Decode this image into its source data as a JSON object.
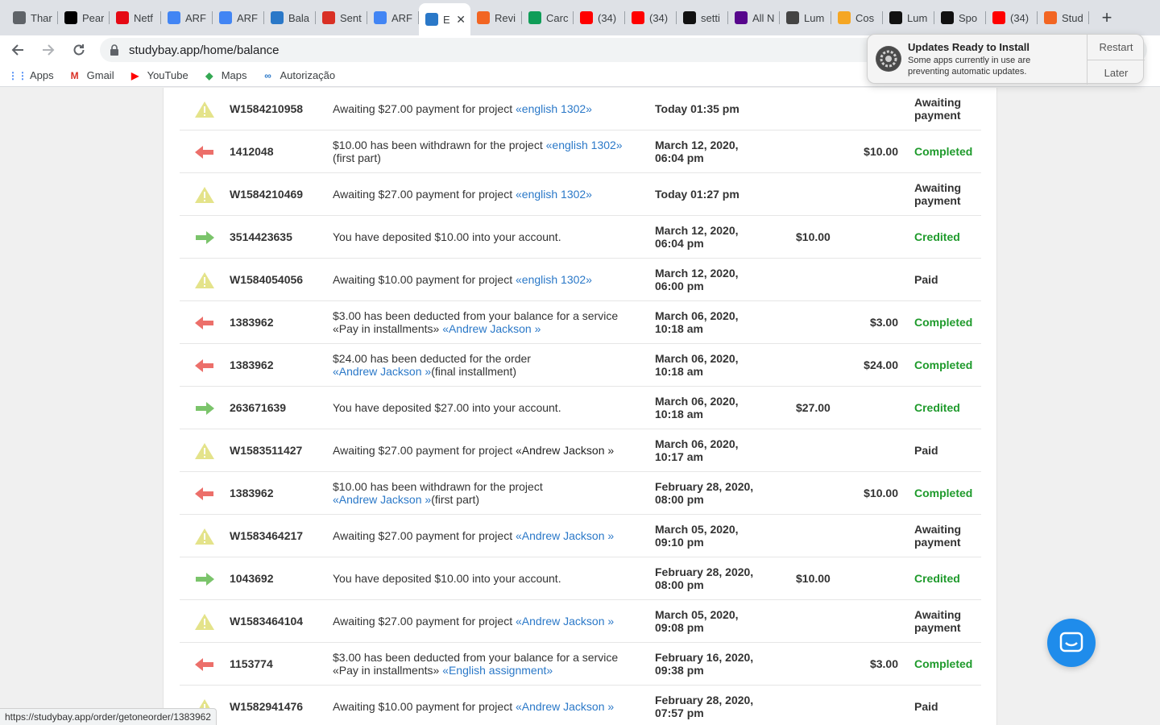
{
  "browser": {
    "tabs": [
      {
        "title": "Thar",
        "icon": "globe-icon",
        "color": "#5f6368"
      },
      {
        "title": "Pear",
        "icon": "pearson-icon",
        "color": "#000000"
      },
      {
        "title": "Netf",
        "icon": "netflix-icon",
        "color": "#e50914"
      },
      {
        "title": "ARF",
        "icon": "docs-icon",
        "color": "#4285f4"
      },
      {
        "title": "ARF",
        "icon": "docs-icon",
        "color": "#4285f4"
      },
      {
        "title": "Bala",
        "icon": "studybay-icon",
        "color": "#2a78c8"
      },
      {
        "title": "Sent",
        "icon": "gmail-icon",
        "color": "#d93025"
      },
      {
        "title": "ARF",
        "icon": "docs-icon",
        "color": "#4285f4"
      },
      {
        "title": "E",
        "icon": "studybay-icon",
        "color": "#2a78c8",
        "active": true
      },
      {
        "title": "Revi",
        "icon": "star-icon",
        "color": "#f26522"
      },
      {
        "title": "Carc",
        "icon": "square-icon",
        "color": "#0f9d58"
      },
      {
        "title": "(34)",
        "icon": "youtube-icon",
        "color": "#ff0000"
      },
      {
        "title": "(34)",
        "icon": "youtube-icon",
        "color": "#ff0000"
      },
      {
        "title": "setti",
        "icon": "k-icon",
        "color": "#111111"
      },
      {
        "title": "All N",
        "icon": "nyu-icon",
        "color": "#57068c"
      },
      {
        "title": "Lum",
        "icon": "lumen-icon",
        "color": "#444444"
      },
      {
        "title": "Cos",
        "icon": "u-icon",
        "color": "#f5a623"
      },
      {
        "title": "Lum",
        "icon": "l-icon",
        "color": "#111111"
      },
      {
        "title": "Spo",
        "icon": "k-icon",
        "color": "#111111"
      },
      {
        "title": "(34)",
        "icon": "youtube-icon",
        "color": "#ff0000"
      },
      {
        "title": "Stud",
        "icon": "star-icon",
        "color": "#f26522"
      }
    ],
    "url": "studybay.app/home/balance",
    "bookmarks": [
      {
        "label": "Apps",
        "icon": "apps-grid-icon"
      },
      {
        "label": "Gmail",
        "icon": "gmail-icon"
      },
      {
        "label": "YouTube",
        "icon": "youtube-icon"
      },
      {
        "label": "Maps",
        "icon": "maps-icon"
      },
      {
        "label": "Autorização",
        "icon": "studybay-icon"
      }
    ],
    "status_url": "https://studybay.app/order/getoneorder/1383962"
  },
  "notification": {
    "title": "Updates Ready to Install",
    "body": "Some apps currently in use are preventing automatic updates.",
    "restart": "Restart",
    "later": "Later"
  },
  "transactions": [
    {
      "type": "warning",
      "id": "W1584210958",
      "text": "Awaiting $27.00 payment for project ",
      "link": "«english 1302»",
      "date1": "Today 01:35 pm",
      "date2": "",
      "credit": "",
      "debit": "",
      "status1": "Awaiting",
      "status2": "payment",
      "green": false
    },
    {
      "type": "out",
      "id": "1412048",
      "text": "$10.00 has been withdrawn for the project ",
      "link": "«english 1302»",
      "suffix": "(first part)",
      "date1": "March 12, 2020,",
      "date2": "06:04 pm",
      "credit": "",
      "debit": "$10.00",
      "status1": "Completed",
      "status2": "",
      "green": true
    },
    {
      "type": "warning",
      "id": "W1584210469",
      "text": "Awaiting $27.00 payment for project ",
      "link": "«english 1302»",
      "date1": "Today 01:27 pm",
      "date2": "",
      "credit": "",
      "debit": "",
      "status1": "Awaiting",
      "status2": "payment",
      "green": false
    },
    {
      "type": "in",
      "id": "3514423635",
      "text": "You have deposited $10.00 into your account.",
      "link": "",
      "date1": "March 12, 2020,",
      "date2": "06:04 pm",
      "credit": "$10.00",
      "debit": "",
      "status1": "Credited",
      "status2": "",
      "green": true
    },
    {
      "type": "warning",
      "id": "W1584054056",
      "text": "Awaiting $10.00 payment for project ",
      "link": "«english 1302»",
      "date1": "March 12, 2020,",
      "date2": "06:00 pm",
      "credit": "",
      "debit": "",
      "status1": "Paid",
      "status2": "",
      "green": false
    },
    {
      "type": "out",
      "id": "1383962",
      "text": "$3.00 has been deducted from your balance for a service",
      "line2": "«Pay in installments» ",
      "link2": "«Andrew Jackson »",
      "date1": "March 06, 2020,",
      "date2": "10:18 am",
      "credit": "",
      "debit": "$3.00",
      "status1": "Completed",
      "status2": "",
      "green": true
    },
    {
      "type": "out",
      "id": "1383962",
      "text": "$24.00 has been deducted for the order",
      "link2": "«Andrew Jackson »",
      "suffix2": "(final installment)",
      "date1": "March 06, 2020,",
      "date2": "10:18 am",
      "credit": "",
      "debit": "$24.00",
      "status1": "Completed",
      "status2": "",
      "green": true
    },
    {
      "type": "in",
      "id": "263671639",
      "text": "You have deposited $27.00 into your account.",
      "link": "",
      "date1": "March 06, 2020,",
      "date2": "10:18 am",
      "credit": "$27.00",
      "debit": "",
      "status1": "Credited",
      "status2": "",
      "green": true
    },
    {
      "type": "warning",
      "id": "W1583511427",
      "text": "Awaiting $27.00 payment for project ",
      "plainlink": "«Andrew Jackson »",
      "date1": "March 06, 2020,",
      "date2": "10:17 am",
      "credit": "",
      "debit": "",
      "status1": "Paid",
      "status2": "",
      "green": false
    },
    {
      "type": "out",
      "id": "1383962",
      "text": "$10.00 has been withdrawn for the project",
      "link2": "«Andrew Jackson »",
      "suffix2": "(first part)",
      "date1": "February 28, 2020,",
      "date2": "08:00 pm",
      "credit": "",
      "debit": "$10.00",
      "status1": "Completed",
      "status2": "",
      "green": true
    },
    {
      "type": "warning",
      "id": "W1583464217",
      "text": "Awaiting $27.00 payment for project ",
      "link": "«Andrew Jackson »",
      "date1": "March 05, 2020,",
      "date2": "09:10 pm",
      "credit": "",
      "debit": "",
      "status1": "Awaiting",
      "status2": "payment",
      "green": false
    },
    {
      "type": "in",
      "id": "1043692",
      "text": "You have deposited $10.00 into your account.",
      "link": "",
      "date1": "February 28, 2020,",
      "date2": "08:00 pm",
      "credit": "$10.00",
      "debit": "",
      "status1": "Credited",
      "status2": "",
      "green": true
    },
    {
      "type": "warning",
      "id": "W1583464104",
      "text": "Awaiting $27.00 payment for project ",
      "link": "«Andrew Jackson »",
      "date1": "March 05, 2020,",
      "date2": "09:08 pm",
      "credit": "",
      "debit": "",
      "status1": "Awaiting",
      "status2": "payment",
      "green": false
    },
    {
      "type": "out",
      "id": "1153774",
      "text": "$3.00 has been deducted from your balance for a service",
      "line2": "«Pay in installments» ",
      "link2": "«English assignment»",
      "date1": "February 16, 2020,",
      "date2": "09:38 pm",
      "credit": "",
      "debit": "$3.00",
      "status1": "Completed",
      "status2": "",
      "green": true
    },
    {
      "type": "warning",
      "id": "W1582941476",
      "text": "Awaiting $10.00 payment for project ",
      "link": "«Andrew Jackson »",
      "date1": "February 28, 2020,",
      "date2": "07:57 pm",
      "credit": "",
      "debit": "",
      "status1": "Paid",
      "status2": "",
      "green": false
    }
  ],
  "colors": {
    "warning": "#e4e38a",
    "out": "#ec6f6a",
    "in": "#7bc46b",
    "link": "#2a78c8",
    "status_green": "#1e9a2b"
  }
}
